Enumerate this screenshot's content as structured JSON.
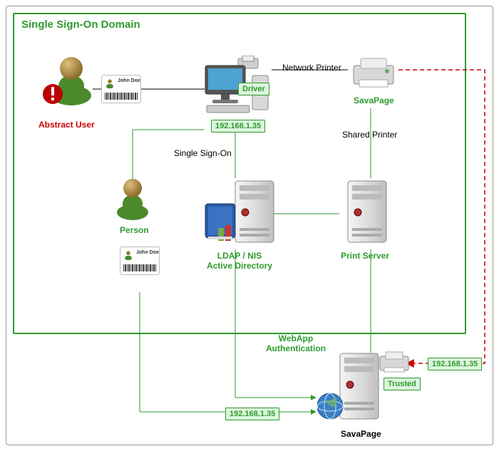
{
  "domain": {
    "title": "Single Sign-On Domain"
  },
  "nodes": {
    "abstract_user": {
      "label": "Abstract User"
    },
    "person": {
      "label": "Person"
    },
    "workstation": {
      "ip": "192.168.1.35",
      "driver_badge": "Driver"
    },
    "network_printer": {
      "edge_label": "Network Printer",
      "brand": "SavaPage"
    },
    "ldap": {
      "label_line1": "LDAP / NIS",
      "label_line2": "Active Directory",
      "sso_label": "Single Sign-On"
    },
    "print_server": {
      "label": "Print Server",
      "shared_label": "Shared Printer"
    },
    "savapage": {
      "label": "SavaPage",
      "webapp_label_line1": "WebApp",
      "webapp_label_line2": "Authentication",
      "trusted_badge": "Trusted",
      "ip_right": "192.168.1.35",
      "ip_bottom": "192.168.1.35"
    }
  },
  "idcard": {
    "name": "John Doe"
  }
}
